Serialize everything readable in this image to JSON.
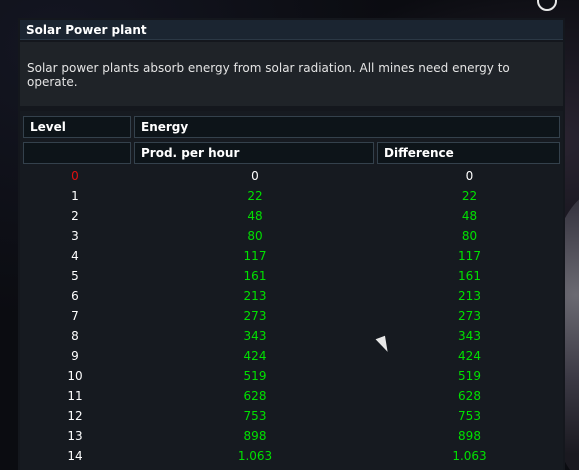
{
  "window": {
    "title": "Solar Power plant",
    "description": "Solar power plants absorb energy from solar radiation. All mines need energy to operate."
  },
  "table": {
    "headers": {
      "level": "Level",
      "energy": "Energy",
      "prod": "Prod. per hour",
      "diff": "Difference"
    },
    "rows": [
      {
        "level": "0",
        "prod": "0",
        "diff": "0"
      },
      {
        "level": "1",
        "prod": "22",
        "diff": "22"
      },
      {
        "level": "2",
        "prod": "48",
        "diff": "48"
      },
      {
        "level": "3",
        "prod": "80",
        "diff": "80"
      },
      {
        "level": "4",
        "prod": "117",
        "diff": "117"
      },
      {
        "level": "5",
        "prod": "161",
        "diff": "161"
      },
      {
        "level": "6",
        "prod": "213",
        "diff": "213"
      },
      {
        "level": "7",
        "prod": "273",
        "diff": "273"
      },
      {
        "level": "8",
        "prod": "343",
        "diff": "343"
      },
      {
        "level": "9",
        "prod": "424",
        "diff": "424"
      },
      {
        "level": "10",
        "prod": "519",
        "diff": "519"
      },
      {
        "level": "11",
        "prod": "628",
        "diff": "628"
      },
      {
        "level": "12",
        "prod": "753",
        "diff": "753"
      },
      {
        "level": "13",
        "prod": "898",
        "diff": "898"
      },
      {
        "level": "14",
        "prod": "1.063",
        "diff": "1.063"
      }
    ]
  },
  "colors": {
    "positive": "#00e000",
    "current_level": "#e01010",
    "header_bg": "#0d1419"
  }
}
